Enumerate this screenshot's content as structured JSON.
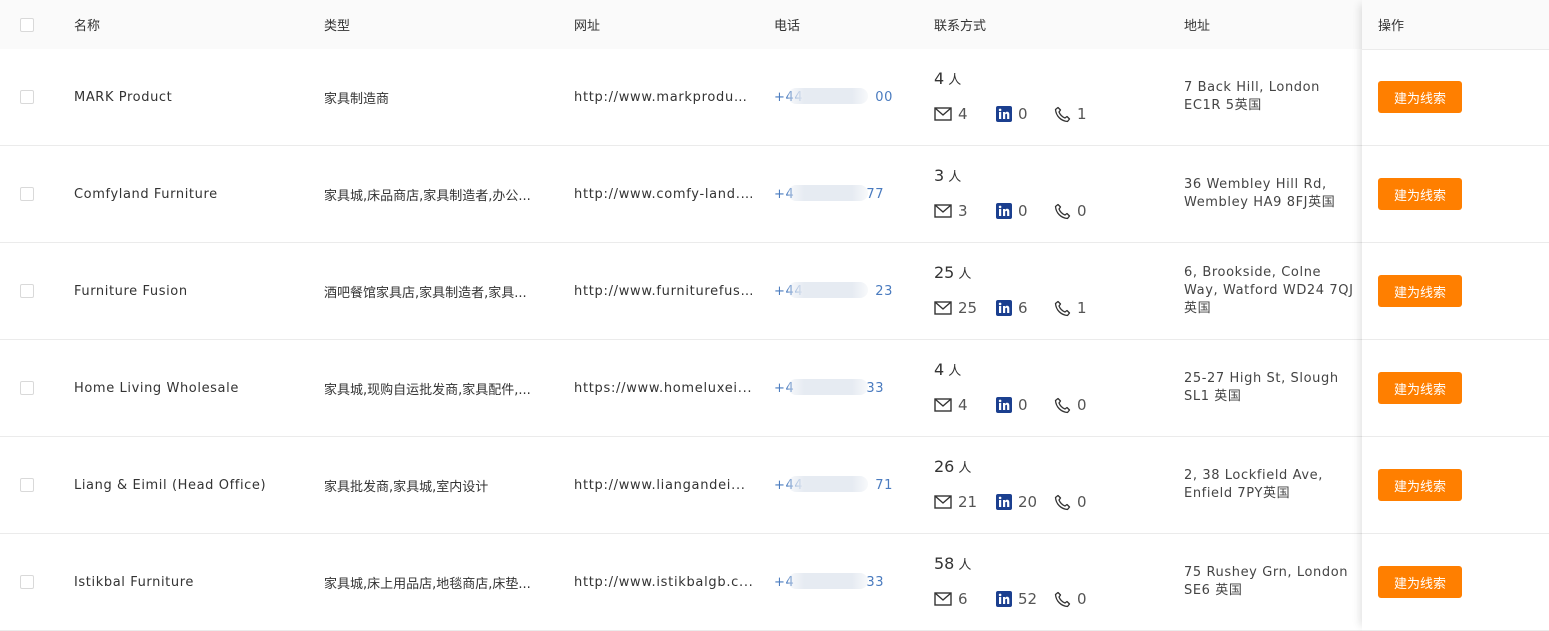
{
  "columns": {
    "name": "名称",
    "type": "类型",
    "url": "网址",
    "phone": "电话",
    "contact": "联系方式",
    "address": "地址",
    "action": "操作"
  },
  "people_unit": "人",
  "action_label": "建为线索",
  "rows": [
    {
      "name": "MARK Product",
      "type": "家具制造商",
      "url": "http://www.markproduc...",
      "phone_prefix": "+44",
      "phone_suffix": "00",
      "people": "4",
      "email": "4",
      "linkedin": "0",
      "phone_count": "1",
      "address": "7 Back Hill, London EC1R 5英国"
    },
    {
      "name": "Comfyland Furniture",
      "type": "家具城,床品商店,家具制造者,办公...",
      "url": "http://www.comfy-land....",
      "phone_prefix": "+4",
      "phone_suffix": "77",
      "people": "3",
      "email": "3",
      "linkedin": "0",
      "phone_count": "0",
      "address": "36 Wembley Hill Rd, Wembley HA9 8FJ英国"
    },
    {
      "name": "Furniture Fusion",
      "type": "酒吧餐馆家具店,家具制造者,家具...",
      "url": "http://www.furniturefus...",
      "phone_prefix": "+44",
      "phone_suffix": "23",
      "people": "25",
      "email": "25",
      "linkedin": "6",
      "phone_count": "1",
      "address": "6, Brookside, Colne Way, Watford WD24 7QJ英国"
    },
    {
      "name": "Home Living Wholesale",
      "type": "家具城,现购自运批发商,家具配件,...",
      "url": "https://www.homeluxei...",
      "phone_prefix": "+4",
      "phone_suffix": "33",
      "people": "4",
      "email": "4",
      "linkedin": "0",
      "phone_count": "0",
      "address": "25-27 High St, Slough SL1 英国"
    },
    {
      "name": "Liang & Eimil (Head Office)",
      "type": "家具批发商,家具城,室内设计",
      "url": "http://www.liangandei...",
      "phone_prefix": "+44",
      "phone_suffix": "71",
      "people": "26",
      "email": "21",
      "linkedin": "20",
      "phone_count": "0",
      "address": "2, 38 Lockfield Ave, Enfield 7PY英国"
    },
    {
      "name": "Istikbal Furniture",
      "type": "家具城,床上用品店,地毯商店,床垫...",
      "url": "http://www.istikbalgb.c...",
      "phone_prefix": "+4",
      "phone_suffix": "33",
      "people": "58",
      "email": "6",
      "linkedin": "52",
      "phone_count": "0",
      "address": "75 Rushey Grn, London SE6 英国"
    }
  ],
  "colors": {
    "accent": "#ff7f00",
    "phone": "#4a7bbf",
    "linkedin": "#0a66c2"
  }
}
